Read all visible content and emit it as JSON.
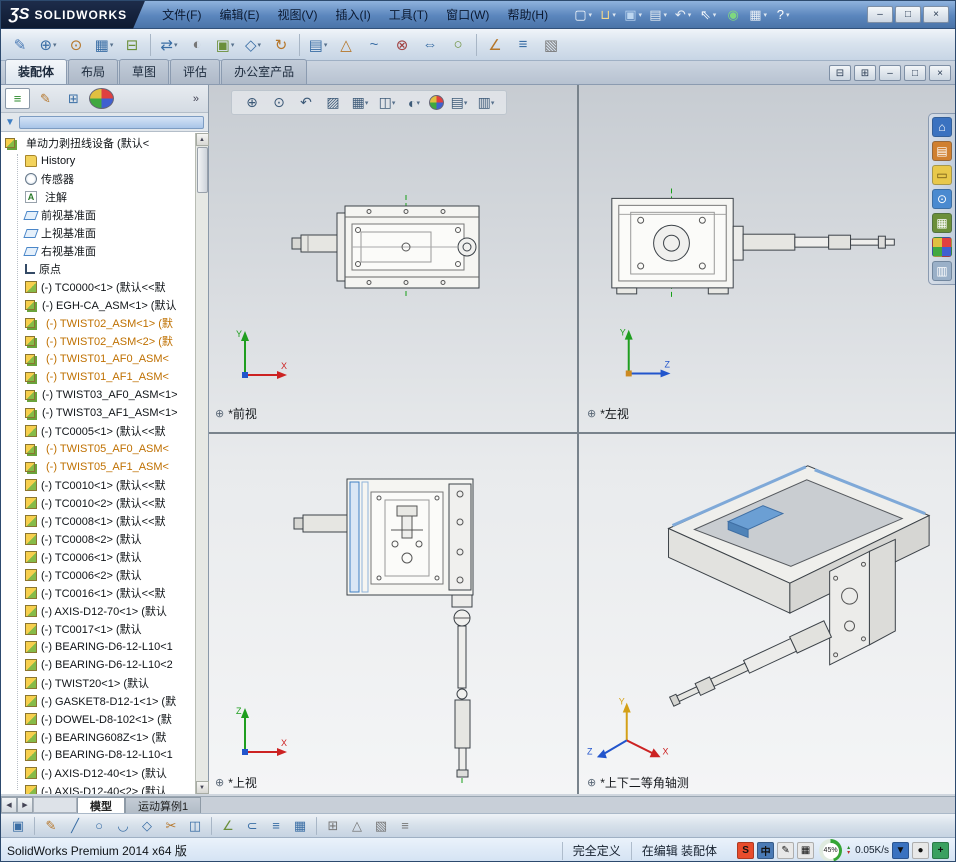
{
  "colors": {
    "titlebar_blue": "#5b86bd",
    "logo_navy": "#0e1a30",
    "toolbar_silver": "#d9e3ee",
    "viewport_top": "#c7ccd2",
    "viewport_bottom": "#f4f5f6",
    "accent_blue": "#3f7fc4",
    "warning_orange": "#e09000",
    "suppressed_text": "#bf7000",
    "triad_x_red": "#cc2222",
    "triad_y_green": "#1f9e1f",
    "triad_z_blue": "#2255cc",
    "centerline_green": "#18a018"
  },
  "titlebar": {
    "logo_glyph": "ƷS",
    "logo_text": "SOLIDWORKS",
    "menus": [
      "文件(F)",
      "编辑(E)",
      "视图(V)",
      "插入(I)",
      "工具(T)",
      "窗口(W)",
      "帮助(H)"
    ],
    "quick_icons": [
      {
        "name": "new-document-icon",
        "glyph": "▢",
        "color": "#f4f8fc",
        "dd": true
      },
      {
        "name": "open-document-icon",
        "glyph": "⊔",
        "color": "#f5d98a",
        "dd": true
      },
      {
        "name": "save-icon",
        "glyph": "▣",
        "color": "#bcd6f0",
        "dd": true
      },
      {
        "name": "print-icon",
        "glyph": "▤",
        "color": "#e0e8f0",
        "dd": true
      },
      {
        "name": "undo-icon",
        "glyph": "↶",
        "color": "#e8eef5",
        "dd": true
      },
      {
        "name": "select-icon",
        "glyph": "⇖",
        "color": "#f4f8fc",
        "dd": true
      },
      {
        "name": "rebuild-icon",
        "glyph": "◉",
        "color": "#7fd87f",
        "dd": false
      },
      {
        "name": "options-icon",
        "glyph": "▦",
        "color": "#e8eef5",
        "dd": true
      },
      {
        "name": "help-icon",
        "glyph": "?",
        "color": "#ffffff",
        "dd": true
      }
    ],
    "window_buttons": [
      {
        "name": "minimize-button",
        "glyph": "–"
      },
      {
        "name": "restore-button",
        "glyph": "□"
      },
      {
        "name": "close-button",
        "glyph": "×"
      }
    ]
  },
  "toolbar": {
    "icons": [
      {
        "name": "edit-component-icon",
        "glyph": "✎",
        "color": "#4a7ab5"
      },
      {
        "name": "insert-components-icon",
        "glyph": "⊕",
        "color": "#3a6ea5",
        "dd": true
      },
      {
        "name": "mate-icon",
        "glyph": "⊙",
        "color": "#b5762a"
      },
      {
        "name": "component-pattern-icon",
        "glyph": "▦",
        "color": "#3a6ea5",
        "dd": true
      },
      {
        "name": "smart-fasteners-icon",
        "glyph": "⊟",
        "color": "#6b8f3a"
      },
      {
        "cls": "sep"
      },
      {
        "name": "move-component-icon",
        "glyph": "⇄",
        "color": "#3a6ea5",
        "dd": true
      },
      {
        "name": "show-hidden-components-icon",
        "glyph": "◐",
        "color": "#777777"
      },
      {
        "name": "assembly-features-icon",
        "glyph": "▣",
        "color": "#6b8f3a",
        "dd": true
      },
      {
        "name": "reference-geometry-icon",
        "glyph": "◇",
        "color": "#3a6ea5",
        "dd": true
      },
      {
        "name": "motion-study-icon",
        "glyph": "↻",
        "color": "#b5762a"
      },
      {
        "cls": "sep"
      },
      {
        "name": "bill-of-materials-icon",
        "glyph": "▤",
        "color": "#3a6ea5",
        "dd": true
      },
      {
        "name": "exploded-view-icon",
        "glyph": "△",
        "color": "#b5762a"
      },
      {
        "name": "explode-line-sketch-icon",
        "glyph": "~",
        "color": "#3a6ea5"
      },
      {
        "name": "interference-detection-icon",
        "glyph": "⊗",
        "color": "#a04040"
      },
      {
        "name": "clearance-verification-icon",
        "glyph": "⇔",
        "color": "#3a6ea5"
      },
      {
        "name": "hole-alignment-icon",
        "glyph": "○",
        "color": "#6b8f3a"
      },
      {
        "cls": "sep"
      },
      {
        "name": "measure-icon",
        "glyph": "∠",
        "color": "#b5762a"
      },
      {
        "name": "mass-properties-icon",
        "glyph": "≡",
        "color": "#3a6ea5"
      },
      {
        "name": "section-properties-icon",
        "glyph": "▧",
        "color": "#777777"
      }
    ]
  },
  "command_tabs": {
    "tabs": [
      {
        "label": "装配体",
        "active": true
      },
      {
        "label": "布局"
      },
      {
        "label": "草图"
      },
      {
        "label": "评估"
      },
      {
        "label": "办公室产品"
      }
    ],
    "doc_buttons": [
      {
        "name": "doc-cascade-button",
        "glyph": "⊟"
      },
      {
        "name": "doc-tile-button",
        "glyph": "⊞"
      },
      {
        "name": "doc-minimize-button",
        "glyph": "–"
      },
      {
        "name": "doc-restore-button",
        "glyph": "□"
      },
      {
        "name": "doc-close-button",
        "glyph": "×"
      }
    ]
  },
  "panel": {
    "manager_tabs": [
      {
        "name": "featuremanager-tab",
        "glyph": "≡",
        "color": "#2e8b2e",
        "active": true
      },
      {
        "name": "propertymanager-tab",
        "glyph": "✎",
        "color": "#b5762a"
      },
      {
        "name": "configurationmanager-tab",
        "glyph": "⊞",
        "color": "#3a6ea5"
      },
      {
        "name": "displaymanager-tab",
        "cls": "ball"
      }
    ],
    "more_label": "»",
    "tree": {
      "items": [
        {
          "label": "单动力剥扭线设备 (默认<",
          "cls": "root i-asm",
          "warn": true
        },
        {
          "label": "History",
          "cls": "i-hist"
        },
        {
          "label": "传感器",
          "cls": "i-sensor"
        },
        {
          "label": "注解",
          "cls": "i-note",
          "warn": true
        },
        {
          "label": "前视基准面",
          "cls": "i-plane"
        },
        {
          "label": "上视基准面",
          "cls": "i-plane"
        },
        {
          "label": "右视基准面",
          "cls": "i-plane"
        },
        {
          "label": "原点",
          "cls": "i-origin"
        },
        {
          "label": "(-) TC0000<1> (默认<<默",
          "cls": "i-part"
        },
        {
          "label": "(-) EGH-CA_ASM<1> (默认",
          "cls": "i-asm"
        },
        {
          "label": "(-) TWIST02_ASM<1> (默",
          "cls": "i-asm orange",
          "warn": true
        },
        {
          "label": "(-) TWIST02_ASM<2> (默",
          "cls": "i-asm orange",
          "warn": true
        },
        {
          "label": "(-) TWIST01_AF0_ASM<",
          "cls": "i-asm orange",
          "warn": true
        },
        {
          "label": "(-) TWIST01_AF1_ASM<",
          "cls": "i-asm orange",
          "warn": true
        },
        {
          "label": "(-) TWIST03_AF0_ASM<1>",
          "cls": "i-asm"
        },
        {
          "label": "(-) TWIST03_AF1_ASM<1>",
          "cls": "i-asm"
        },
        {
          "label": "(-) TC0005<1> (默认<<默",
          "cls": "i-part"
        },
        {
          "label": "(-) TWIST05_AF0_ASM<",
          "cls": "i-asm orange",
          "warn": true
        },
        {
          "label": "(-) TWIST05_AF1_ASM<",
          "cls": "i-asm orange",
          "warn": true
        },
        {
          "label": "(-) TC0010<1> (默认<<默",
          "cls": "i-part"
        },
        {
          "label": "(-) TC0010<2> (默认<<默",
          "cls": "i-part"
        },
        {
          "label": "(-) TC0008<1> (默认<<默",
          "cls": "i-part"
        },
        {
          "label": "(-) TC0008<2> (默认",
          "cls": "i-part"
        },
        {
          "label": "(-) TC0006<1> (默认",
          "cls": "i-part"
        },
        {
          "label": "(-) TC0006<2> (默认",
          "cls": "i-part"
        },
        {
          "label": "(-) TC0016<1> (默认<<默",
          "cls": "i-part"
        },
        {
          "label": "(-) AXIS-D12-70<1> (默认",
          "cls": "i-part"
        },
        {
          "label": "(-) TC0017<1> (默认",
          "cls": "i-part"
        },
        {
          "label": "(-) BEARING-D6-12-L10<1",
          "cls": "i-part"
        },
        {
          "label": "(-) BEARING-D6-12-L10<2",
          "cls": "i-part"
        },
        {
          "label": "(-) TWIST20<1> (默认",
          "cls": "i-part"
        },
        {
          "label": "(-) GASKET8-D12-1<1> (默",
          "cls": "i-part"
        },
        {
          "label": "(-) DOWEL-D8-102<1> (默",
          "cls": "i-part"
        },
        {
          "label": "(-) BEARING608Z<1> (默",
          "cls": "i-part"
        },
        {
          "label": "(-) BEARING-D8-12-L10<1",
          "cls": "i-part"
        },
        {
          "label": "(-) AXIS-D12-40<1> (默认",
          "cls": "i-part"
        },
        {
          "label": "(-) AXIS-D12-40<2> (默认",
          "cls": "i-part"
        }
      ]
    }
  },
  "graphics": {
    "viewports": [
      {
        "label": "*前视"
      },
      {
        "label": "*左视"
      },
      {
        "label": "*上视"
      },
      {
        "label": "*上下二等角轴测"
      }
    ],
    "headsup_icons": [
      {
        "name": "zoom-fit-icon",
        "glyph": "⊕"
      },
      {
        "name": "zoom-area-icon",
        "glyph": "⊙"
      },
      {
        "name": "previous-view-icon",
        "glyph": "↶"
      },
      {
        "name": "section-view-icon",
        "glyph": "▨"
      },
      {
        "name": "view-orientation-icon",
        "glyph": "▦",
        "dd": true
      },
      {
        "name": "display-style-icon",
        "glyph": "◫",
        "dd": true
      },
      {
        "name": "hide-show-items-icon",
        "glyph": "◐",
        "dd": true
      },
      {
        "name": "edit-appearance-icon",
        "cls": "ball"
      },
      {
        "name": "apply-scene-icon",
        "glyph": "▤",
        "dd": true
      },
      {
        "name": "view-settings-icon",
        "glyph": "▥",
        "dd": true
      }
    ],
    "taskpane_icons": [
      {
        "name": "solidworks-resources-icon",
        "glyph": "⌂",
        "bg": "#3a72c0"
      },
      {
        "name": "design-library-icon",
        "glyph": "▤",
        "bg": "#d08030"
      },
      {
        "name": "file-explorer-icon",
        "glyph": "▭",
        "bg": "#e8c84a",
        "color": "#6b5210"
      },
      {
        "name": "search-icon",
        "glyph": "⊙",
        "bg": "#4a8ad0"
      },
      {
        "name": "view-palette-icon",
        "glyph": "▦",
        "bg": "#6b8f3a"
      },
      {
        "name": "appearances-icon",
        "cls": "ball"
      },
      {
        "name": "custom-properties-icon",
        "glyph": "▥",
        "bg": "#9ab0c8"
      }
    ]
  },
  "bottom": {
    "tabs": [
      {
        "label": "模型",
        "active": true
      },
      {
        "label": "运动算例1"
      }
    ]
  },
  "sketchbar": {
    "icons": [
      {
        "name": "save-icon",
        "glyph": "▣",
        "color": "#3a6ea5"
      },
      {
        "cls": "sep"
      },
      {
        "name": "sketch-icon",
        "glyph": "✎",
        "color": "#b5762a"
      },
      {
        "name": "line-icon",
        "glyph": "╱",
        "color": "#3a6ea5"
      },
      {
        "name": "circle-icon",
        "glyph": "○",
        "color": "#3a6ea5"
      },
      {
        "name": "arc-icon",
        "glyph": "◡",
        "color": "#3a6ea5"
      },
      {
        "name": "polygon-icon",
        "glyph": "◇",
        "color": "#3a6ea5"
      },
      {
        "name": "trim-entities-icon",
        "glyph": "✂",
        "color": "#b5762a"
      },
      {
        "name": "mirror-entities-icon",
        "glyph": "◫",
        "color": "#3a6ea5"
      },
      {
        "cls": "sep"
      },
      {
        "name": "smart-dimension-icon",
        "glyph": "∠",
        "color": "#6b8f3a"
      },
      {
        "name": "convert-entities-icon",
        "glyph": "⊂",
        "color": "#3a6ea5"
      },
      {
        "name": "offset-entities-icon",
        "glyph": "≡",
        "color": "#3a6ea5"
      },
      {
        "name": "linear-sketch-pattern-icon",
        "glyph": "▦",
        "color": "#3a6ea5"
      },
      {
        "cls": "sep"
      },
      {
        "name": "grid-snap-icon",
        "glyph": "⊞",
        "color": "#777777"
      },
      {
        "name": "section-display-icon",
        "glyph": "△",
        "color": "#777777"
      },
      {
        "name": "view-cube-icon",
        "glyph": "▧",
        "color": "#777777"
      },
      {
        "name": "display-list-icon",
        "glyph": "≡",
        "color": "#777777"
      }
    ]
  },
  "statusbar": {
    "app_info": "SolidWorks Premium 2014 x64 版",
    "define_state": "完全定义",
    "edit_state": "在编辑 装配体",
    "tray_left": [
      {
        "name": "ime-sogou-icon",
        "glyph": "S",
        "bg": "#e84c2c",
        "color": "#ffffff"
      },
      {
        "name": "ime-lang-icon",
        "glyph": "中",
        "bg": "#4a7ab5",
        "color": "#ffffff"
      },
      {
        "name": "ime-pen-icon",
        "glyph": "✎",
        "bg": "#e8e8e8",
        "color": "#555555"
      },
      {
        "name": "ime-keyboard-icon",
        "glyph": "▦",
        "bg": "#e8e8e8",
        "color": "#555555"
      }
    ],
    "net": {
      "percent": "45%",
      "speed": "0.05K/s"
    },
    "tray_right": [
      {
        "name": "tray-download-icon",
        "glyph": "▼",
        "bg": "#3a72c0",
        "color": "#ffffff"
      },
      {
        "name": "tray-user-icon",
        "glyph": "●",
        "bg": "#e8e8e8",
        "color": "#888888"
      },
      {
        "name": "tray-plus-icon",
        "glyph": "+",
        "bg": "#3aa060",
        "color": "#ffffff"
      }
    ]
  }
}
